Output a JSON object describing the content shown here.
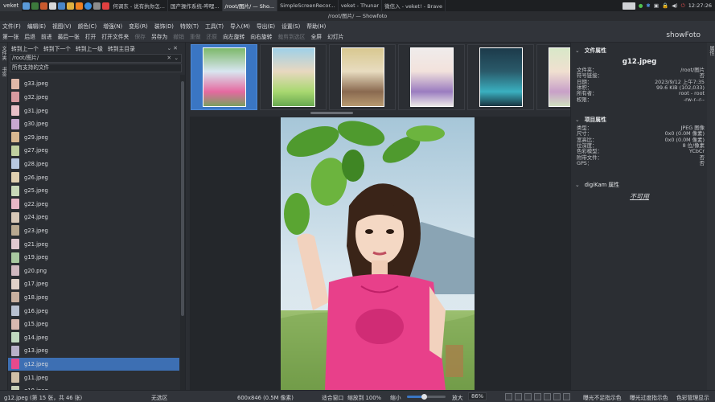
{
  "taskbar": {
    "start_label": "veket",
    "tasks": [
      {
        "label": "何调东 - 说有执你怎...",
        "active": false
      },
      {
        "label": "国产操作系统-哔哩...",
        "active": false
      },
      {
        "label": "/root/图片/ — Sho...",
        "active": true
      },
      {
        "label": "SimpleScreenRecor...",
        "active": false
      },
      {
        "label": "veket - Thunar",
        "active": false
      },
      {
        "label": "微信入 - veket! - Brave",
        "active": false
      }
    ],
    "clock": "12:27:26"
  },
  "window": {
    "title": "/root/图片/ — Showfoto"
  },
  "menu": {
    "items": [
      "文件(F)",
      "编辑(E)",
      "视图(V)",
      "颜色(C)",
      "增强(N)",
      "变形(R)",
      "装饰(D)",
      "特效(T)",
      "工具(T)",
      "导入(M)",
      "导出(E)",
      "设置(S)",
      "帮助(H)"
    ]
  },
  "toolbar": {
    "items": [
      {
        "label": "第一张",
        "disabled": false
      },
      {
        "label": "后退",
        "disabled": false
      },
      {
        "label": "前进",
        "disabled": false
      },
      {
        "label": "最后一张",
        "disabled": false
      },
      {
        "label": "打开",
        "disabled": false
      },
      {
        "label": "打开文件夹",
        "disabled": false
      },
      {
        "label": "保存",
        "disabled": true
      },
      {
        "label": "另存为",
        "disabled": false
      },
      {
        "label": "撤销",
        "disabled": true
      },
      {
        "label": "重做",
        "disabled": true
      },
      {
        "label": "还原",
        "disabled": true
      },
      {
        "label": "向左旋转",
        "disabled": false
      },
      {
        "label": "向右旋转",
        "disabled": false
      },
      {
        "label": "裁剪到选区",
        "disabled": true
      },
      {
        "label": "全屏",
        "disabled": false
      },
      {
        "label": "幻灯片",
        "disabled": false
      }
    ],
    "brand": "showFoto"
  },
  "left_strip": {
    "tab1": "文件夹",
    "tab2": "书签"
  },
  "left_panel": {
    "nav": [
      "转到上一个",
      "转到下一个",
      "转到上一级",
      "转到主目录"
    ],
    "path": "/root/图片/",
    "filter": "所有支持的文件",
    "files": [
      {
        "name": "g33.jpeg",
        "selected": false
      },
      {
        "name": "g32.jpeg",
        "selected": false
      },
      {
        "name": "g31.jpeg",
        "selected": false
      },
      {
        "name": "g30.jpeg",
        "selected": false
      },
      {
        "name": "g29.jpeg",
        "selected": false
      },
      {
        "name": "g27.jpeg",
        "selected": false
      },
      {
        "name": "g28.jpeg",
        "selected": false
      },
      {
        "name": "g26.jpeg",
        "selected": false
      },
      {
        "name": "g25.jpeg",
        "selected": false
      },
      {
        "name": "g22.jpeg",
        "selected": false
      },
      {
        "name": "g24.jpeg",
        "selected": false
      },
      {
        "name": "g23.jpeg",
        "selected": false
      },
      {
        "name": "g21.jpeg",
        "selected": false
      },
      {
        "name": "g19.jpeg",
        "selected": false
      },
      {
        "name": "g20.png",
        "selected": false
      },
      {
        "name": "g17.jpeg",
        "selected": false
      },
      {
        "name": "g18.jpeg",
        "selected": false
      },
      {
        "name": "g16.jpeg",
        "selected": false
      },
      {
        "name": "g15.jpeg",
        "selected": false
      },
      {
        "name": "g14.jpeg",
        "selected": false
      },
      {
        "name": "g13.jpeg",
        "selected": false
      },
      {
        "name": "g12.jpeg",
        "selected": true
      },
      {
        "name": "g11.jpeg",
        "selected": false
      },
      {
        "name": "g10.jpeg",
        "selected": false
      }
    ]
  },
  "right_panel": {
    "file_section_title": "文件属性",
    "file_name": "g12.jpeg",
    "file_props": [
      {
        "k": "文件夹：",
        "v": "/root/图片"
      },
      {
        "k": "符号链接：",
        "v": "否"
      },
      {
        "k": "日期：",
        "v": "2023/9/12 上午7:35"
      },
      {
        "k": "体积：",
        "v": "99.6 KiB (102,033)"
      },
      {
        "k": "所有者：",
        "v": "root - root"
      },
      {
        "k": "权限：",
        "v": "-rw-r--r--"
      }
    ],
    "item_section_title": "项目属性",
    "item_props": [
      {
        "k": "类型：",
        "v": "JPEG 图像"
      },
      {
        "k": "尺寸：",
        "v": "0x0 (0.0M 像素)"
      },
      {
        "k": "宽高比：",
        "v": "0x0 (0.0M 像素)"
      },
      {
        "k": "位深度：",
        "v": "8 位/像素"
      },
      {
        "k": "色彩模型：",
        "v": "YCbCr"
      },
      {
        "k": "附带文件：",
        "v": "否"
      },
      {
        "k": "GPS：",
        "v": "否"
      }
    ],
    "digikam_section_title": "digiKam 属性",
    "digikam_value": "不可用"
  },
  "right_strip": {
    "tab": "属性"
  },
  "statusbar": {
    "file_info": "g12.jpeg (第 15 张，共 46 张)",
    "selection": "无选区",
    "image_size": "600x846 (0.5M 像素)",
    "fit_window": "适合窗口",
    "zoom_to_100": "缩放到 100%",
    "zoom_out": "缩小",
    "zoom_in": "放大",
    "zoom_value": "86%",
    "zoom_level": 0.86,
    "under_exposure": "曝光不足指示色",
    "over_exposure": "曝光过度指示色",
    "color_manage": "色彩管理显示"
  }
}
